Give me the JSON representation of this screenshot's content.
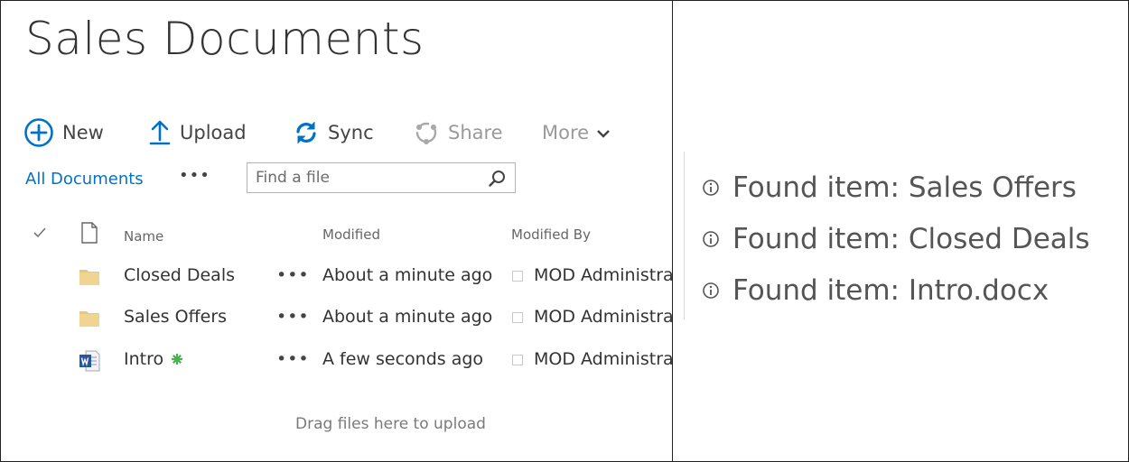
{
  "library": {
    "title": "Sales Documents"
  },
  "commands": {
    "new": "New",
    "upload": "Upload",
    "sync": "Sync",
    "share": "Share",
    "more": "More"
  },
  "view": {
    "all_documents": "All Documents",
    "ellipsis": "•••",
    "search_placeholder": "Find a file"
  },
  "columns": {
    "name": "Name",
    "modified": "Modified",
    "modified_by": "Modified By"
  },
  "files": [
    {
      "name": "Closed Deals",
      "type": "folder",
      "modified": "About a minute ago",
      "modified_by": "MOD Administra"
    },
    {
      "name": "Sales Offers",
      "type": "folder",
      "modified": "About a minute ago",
      "modified_by": "MOD Administra"
    },
    {
      "name": "Intro",
      "type": "word-document",
      "is_new": true,
      "modified": "A few seconds ago",
      "modified_by": "MOD Administra"
    }
  ],
  "row_menu": "•••",
  "drop_hint": "Drag files here to upload",
  "results": [
    "Found item: Sales Offers",
    "Found item: Closed Deals",
    "Found item: Intro.docx"
  ],
  "colors": {
    "accent": "#0072c6",
    "folder": "#e8c77c",
    "word": "#2b579a",
    "new_badge": "#4caf50"
  },
  "icons": [
    "add-circle-icon",
    "upload-arrow-icon",
    "sync-icon",
    "share-icon",
    "chevron-down-icon",
    "search-icon",
    "checkmark-icon",
    "document-icon",
    "folder-icon",
    "word-file-icon",
    "new-badge-icon",
    "info-icon"
  ]
}
